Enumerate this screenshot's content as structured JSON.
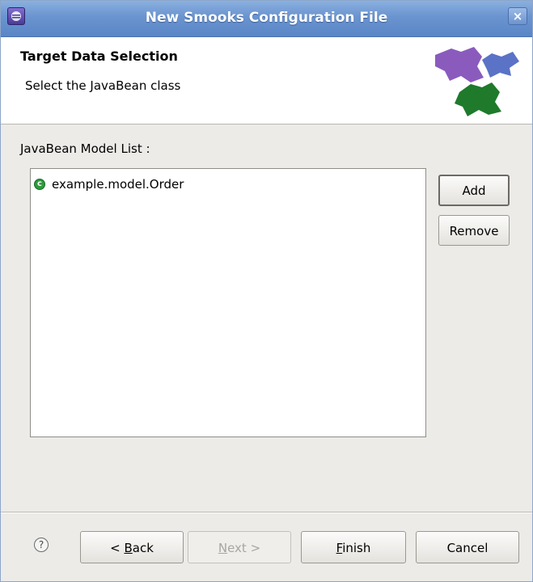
{
  "window": {
    "title": "New Smooks Configuration File",
    "close_icon": "close-icon",
    "app_icon": "eclipse-app-icon"
  },
  "banner": {
    "title": "Target Data Selection",
    "description": "Select the JavaBean class",
    "image_icon": "wizard-banner-shapes-icon"
  },
  "model_list": {
    "label": "JavaBean Model List :",
    "items": [
      {
        "label": "example.model.Order",
        "icon": "class-icon"
      }
    ]
  },
  "side_buttons": {
    "add_label": "Add",
    "remove_label": "Remove"
  },
  "footer": {
    "help_icon": "help-icon",
    "back": {
      "prefix": "< ",
      "mnemonic": "B",
      "rest": "ack"
    },
    "next": {
      "mnemonic": "N",
      "rest": "ext >"
    },
    "finish": {
      "mnemonic": "F",
      "rest": "inish"
    },
    "cancel_label": "Cancel"
  },
  "colors": {
    "titlebar": "#6a94cf",
    "dialog_bg": "#ecebe8",
    "class_icon_green": "#2e9b3c",
    "shape_purple": "#8a5bbd",
    "shape_blue": "#5a73c6",
    "shape_green": "#1f7a2c"
  }
}
